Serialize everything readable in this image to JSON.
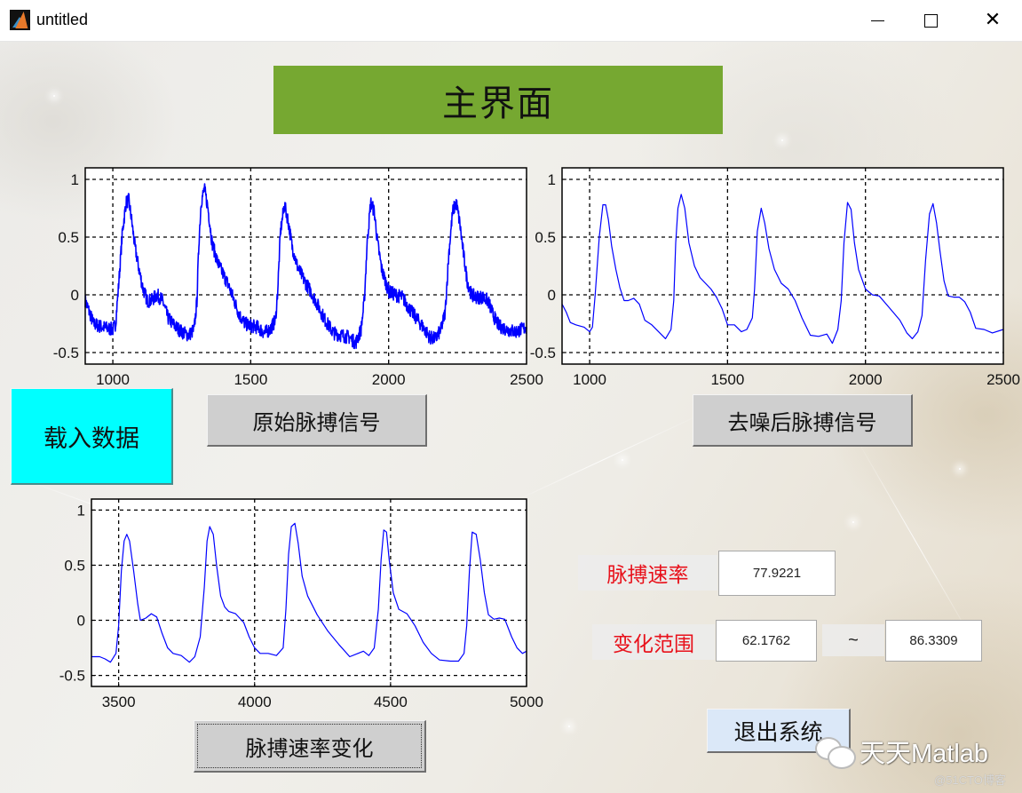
{
  "window": {
    "title": "untitled",
    "app_icon": "matlab-icon",
    "controls": [
      "minimize-icon",
      "maximize-icon",
      "close-icon"
    ]
  },
  "header": {
    "title": "主界面",
    "panel_color": "#76a831"
  },
  "buttons": {
    "load_data": "载入数据",
    "raw_signal": "原始脉搏信号",
    "denoised_signal": "去噪后脉搏信号",
    "rate_change": "脉搏速率变化",
    "exit": "退出系统"
  },
  "results": {
    "pulse_rate_label": "脉搏速率",
    "pulse_rate_value": "77.9221",
    "range_label": "变化范围",
    "range_min": "62.1762",
    "range_separator": "~",
    "range_max": "86.3309"
  },
  "watermark": {
    "text": "天天Matlab",
    "icon": "wechat-icon",
    "source": "@51CTO博客"
  },
  "colors": {
    "signal": "#0000ff",
    "load_button": "#00ffff",
    "label_text": "#e8111b"
  },
  "chart_data": [
    {
      "id": "raw",
      "type": "line",
      "title": "",
      "xlabel": "",
      "ylabel": "",
      "xlim": [
        900,
        2500
      ],
      "ylim": [
        -0.6,
        1.1
      ],
      "xticks": [
        1000,
        1500,
        2000,
        2500
      ],
      "yticks": [
        -0.5,
        0,
        0.5,
        1
      ],
      "ytick_labels": [
        "-0.5",
        "0",
        "0.5",
        "1"
      ],
      "grid": true,
      "noisy": true,
      "series": [
        {
          "name": "原始脉搏信号",
          "color": "#0000ff",
          "x": [
            900,
            915,
            930,
            950,
            980,
            1000,
            1010,
            1020,
            1035,
            1048,
            1058,
            1068,
            1080,
            1095,
            1110,
            1125,
            1140,
            1160,
            1180,
            1200,
            1225,
            1250,
            1275,
            1295,
            1305,
            1312,
            1320,
            1332,
            1345,
            1360,
            1380,
            1400,
            1420,
            1440,
            1460,
            1480,
            1500,
            1525,
            1550,
            1570,
            1590,
            1598,
            1608,
            1622,
            1635,
            1650,
            1670,
            1695,
            1720,
            1745,
            1770,
            1800,
            1830,
            1860,
            1880,
            1900,
            1912,
            1922,
            1935,
            1948,
            1960,
            1975,
            2000,
            2025,
            2050,
            2075,
            2100,
            2125,
            2150,
            2170,
            2190,
            2205,
            2218,
            2232,
            2245,
            2258,
            2270,
            2285,
            2300,
            2320,
            2340,
            2360,
            2380,
            2400,
            2430,
            2460,
            2500
          ],
          "y": [
            -0.05,
            -0.15,
            -0.25,
            -0.27,
            -0.29,
            -0.3,
            -0.25,
            0.05,
            0.55,
            0.8,
            0.82,
            0.65,
            0.42,
            0.22,
            0.05,
            -0.05,
            -0.05,
            0.0,
            -0.05,
            -0.2,
            -0.27,
            -0.32,
            -0.35,
            -0.3,
            -0.05,
            0.45,
            0.8,
            0.92,
            0.75,
            0.45,
            0.28,
            0.18,
            0.08,
            -0.05,
            -0.18,
            -0.25,
            -0.27,
            -0.28,
            -0.33,
            -0.3,
            -0.22,
            0.05,
            0.55,
            0.78,
            0.65,
            0.42,
            0.24,
            0.12,
            0.02,
            -0.1,
            -0.22,
            -0.33,
            -0.35,
            -0.37,
            -0.42,
            -0.3,
            -0.05,
            0.45,
            0.8,
            0.72,
            0.45,
            0.22,
            0.03,
            0.0,
            -0.02,
            -0.12,
            -0.2,
            -0.28,
            -0.37,
            -0.38,
            -0.3,
            -0.15,
            0.35,
            0.72,
            0.8,
            0.62,
            0.38,
            0.12,
            0.0,
            -0.02,
            -0.02,
            -0.05,
            -0.18,
            -0.27,
            -0.3,
            -0.32,
            -0.28
          ]
        }
      ]
    },
    {
      "id": "denoised",
      "type": "line",
      "title": "",
      "xlabel": "",
      "ylabel": "",
      "xlim": [
        900,
        2500
      ],
      "ylim": [
        -0.6,
        1.1
      ],
      "xticks": [
        1000,
        1500,
        2000,
        2500
      ],
      "yticks": [
        -0.5,
        0,
        0.5,
        1
      ],
      "ytick_labels": [
        "-0.5",
        "0",
        "0.5",
        "1"
      ],
      "grid": true,
      "noisy": false,
      "series": [
        {
          "name": "去噪后脉搏信号",
          "color": "#0000ff",
          "x": [
            900,
            915,
            930,
            950,
            980,
            1000,
            1010,
            1020,
            1035,
            1048,
            1058,
            1068,
            1080,
            1095,
            1110,
            1125,
            1140,
            1160,
            1180,
            1200,
            1225,
            1250,
            1275,
            1295,
            1305,
            1312,
            1320,
            1332,
            1345,
            1360,
            1380,
            1400,
            1420,
            1440,
            1460,
            1480,
            1500,
            1525,
            1550,
            1570,
            1590,
            1598,
            1608,
            1622,
            1635,
            1650,
            1670,
            1695,
            1720,
            1745,
            1770,
            1800,
            1830,
            1860,
            1880,
            1900,
            1912,
            1922,
            1935,
            1948,
            1960,
            1975,
            2000,
            2025,
            2050,
            2075,
            2100,
            2125,
            2150,
            2170,
            2190,
            2205,
            2218,
            2232,
            2245,
            2258,
            2270,
            2285,
            2300,
            2320,
            2340,
            2360,
            2380,
            2400,
            2430,
            2460,
            2500
          ],
          "y": [
            -0.08,
            -0.15,
            -0.24,
            -0.26,
            -0.28,
            -0.32,
            -0.28,
            0.0,
            0.5,
            0.78,
            0.78,
            0.65,
            0.42,
            0.22,
            0.06,
            -0.05,
            -0.05,
            -0.03,
            -0.08,
            -0.22,
            -0.26,
            -0.32,
            -0.38,
            -0.3,
            -0.05,
            0.45,
            0.75,
            0.87,
            0.75,
            0.45,
            0.25,
            0.15,
            0.1,
            0.05,
            -0.02,
            -0.12,
            -0.26,
            -0.26,
            -0.32,
            -0.3,
            -0.2,
            0.05,
            0.55,
            0.75,
            0.62,
            0.4,
            0.22,
            0.1,
            0.05,
            -0.05,
            -0.2,
            -0.35,
            -0.36,
            -0.34,
            -0.42,
            -0.3,
            -0.05,
            0.45,
            0.8,
            0.74,
            0.45,
            0.22,
            0.05,
            0.0,
            -0.01,
            -0.08,
            -0.15,
            -0.22,
            -0.33,
            -0.38,
            -0.32,
            -0.18,
            0.3,
            0.7,
            0.79,
            0.62,
            0.38,
            0.12,
            -0.01,
            -0.02,
            -0.02,
            -0.06,
            -0.15,
            -0.29,
            -0.3,
            -0.33,
            -0.3
          ]
        }
      ]
    },
    {
      "id": "rate",
      "type": "line",
      "title": "",
      "xlabel": "",
      "ylabel": "",
      "xlim": [
        3400,
        5000
      ],
      "ylim": [
        -0.6,
        1.1
      ],
      "xticks": [
        3500,
        4000,
        4500,
        5000
      ],
      "yticks": [
        -0.5,
        0,
        0.5,
        1
      ],
      "ytick_labels": [
        "-0.5",
        "0",
        "0.5",
        "1"
      ],
      "grid": true,
      "noisy": false,
      "series": [
        {
          "name": "脉搏速率变化",
          "color": "#0000ff",
          "x": [
            3400,
            3430,
            3450,
            3470,
            3490,
            3500,
            3510,
            3520,
            3530,
            3540,
            3555,
            3570,
            3580,
            3600,
            3620,
            3640,
            3660,
            3680,
            3700,
            3730,
            3760,
            3780,
            3800,
            3815,
            3825,
            3835,
            3848,
            3860,
            3875,
            3890,
            3905,
            3930,
            3960,
            3980,
            4000,
            4020,
            4050,
            4080,
            4105,
            4115,
            4125,
            4135,
            4148,
            4160,
            4175,
            4195,
            4230,
            4270,
            4310,
            4350,
            4380,
            4400,
            4420,
            4440,
            4455,
            4465,
            4475,
            4485,
            4495,
            4510,
            4530,
            4560,
            4590,
            4620,
            4650,
            4680,
            4720,
            4750,
            4770,
            4780,
            4790,
            4800,
            4815,
            4830,
            4845,
            4860,
            4880,
            4900,
            4920,
            4945,
            4965,
            4985,
            5000
          ],
          "y": [
            -0.33,
            -0.33,
            -0.35,
            -0.38,
            -0.3,
            -0.05,
            0.45,
            0.72,
            0.78,
            0.72,
            0.45,
            0.15,
            0.0,
            0.02,
            0.06,
            0.03,
            -0.12,
            -0.25,
            -0.3,
            -0.32,
            -0.38,
            -0.33,
            -0.15,
            0.3,
            0.72,
            0.85,
            0.78,
            0.5,
            0.22,
            0.12,
            0.08,
            0.06,
            -0.02,
            -0.15,
            -0.25,
            -0.3,
            -0.3,
            -0.32,
            -0.25,
            0.1,
            0.6,
            0.85,
            0.88,
            0.7,
            0.4,
            0.22,
            0.05,
            -0.1,
            -0.22,
            -0.33,
            -0.3,
            -0.28,
            -0.32,
            -0.25,
            0.1,
            0.55,
            0.82,
            0.8,
            0.55,
            0.25,
            0.1,
            0.06,
            -0.05,
            -0.2,
            -0.3,
            -0.36,
            -0.37,
            -0.37,
            -0.3,
            -0.05,
            0.45,
            0.8,
            0.78,
            0.55,
            0.25,
            0.05,
            0.01,
            0.02,
            0.01,
            -0.15,
            -0.25,
            -0.3,
            -0.28
          ]
        }
      ]
    }
  ]
}
